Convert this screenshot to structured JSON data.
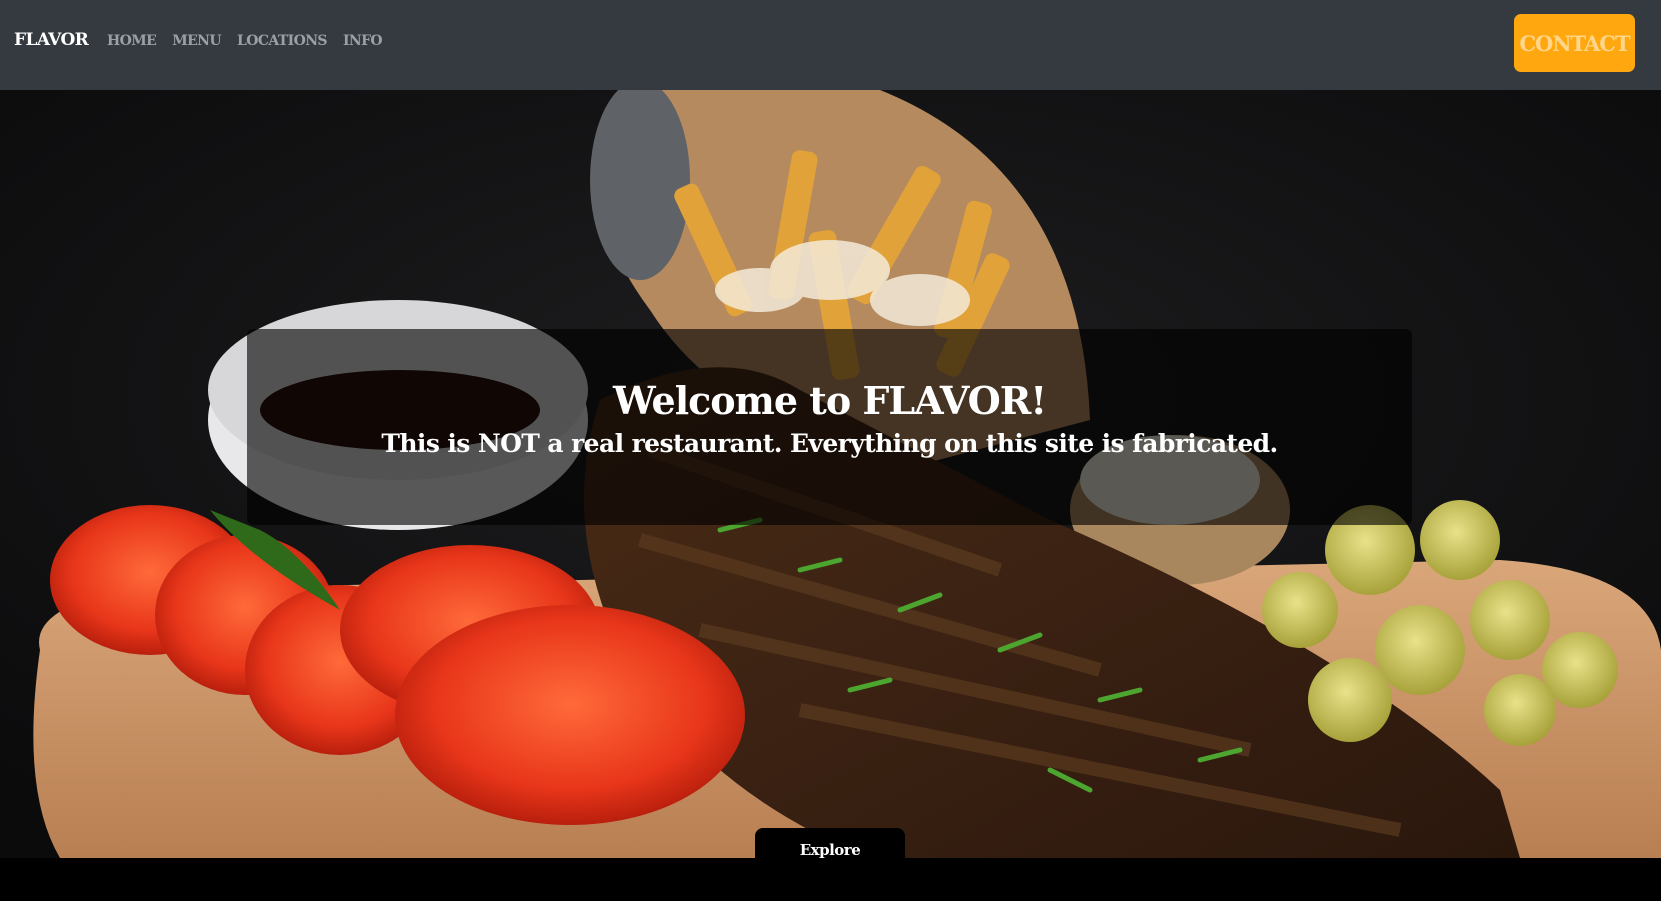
{
  "navbar": {
    "brand": "FLAVOR",
    "links": [
      "HOME",
      "MENU",
      "LOCATIONS",
      "INFO"
    ],
    "contact_label": "CONTACT"
  },
  "hero": {
    "title": "Welcome to FLAVOR!",
    "subtitle": "This is NOT a real restaurant. Everything on this site is fabricated.",
    "explore_label": "Explore"
  },
  "colors": {
    "navbar_bg": "#343a40",
    "accent": "#ffa70f",
    "nav_link": "#9aa0a6"
  }
}
